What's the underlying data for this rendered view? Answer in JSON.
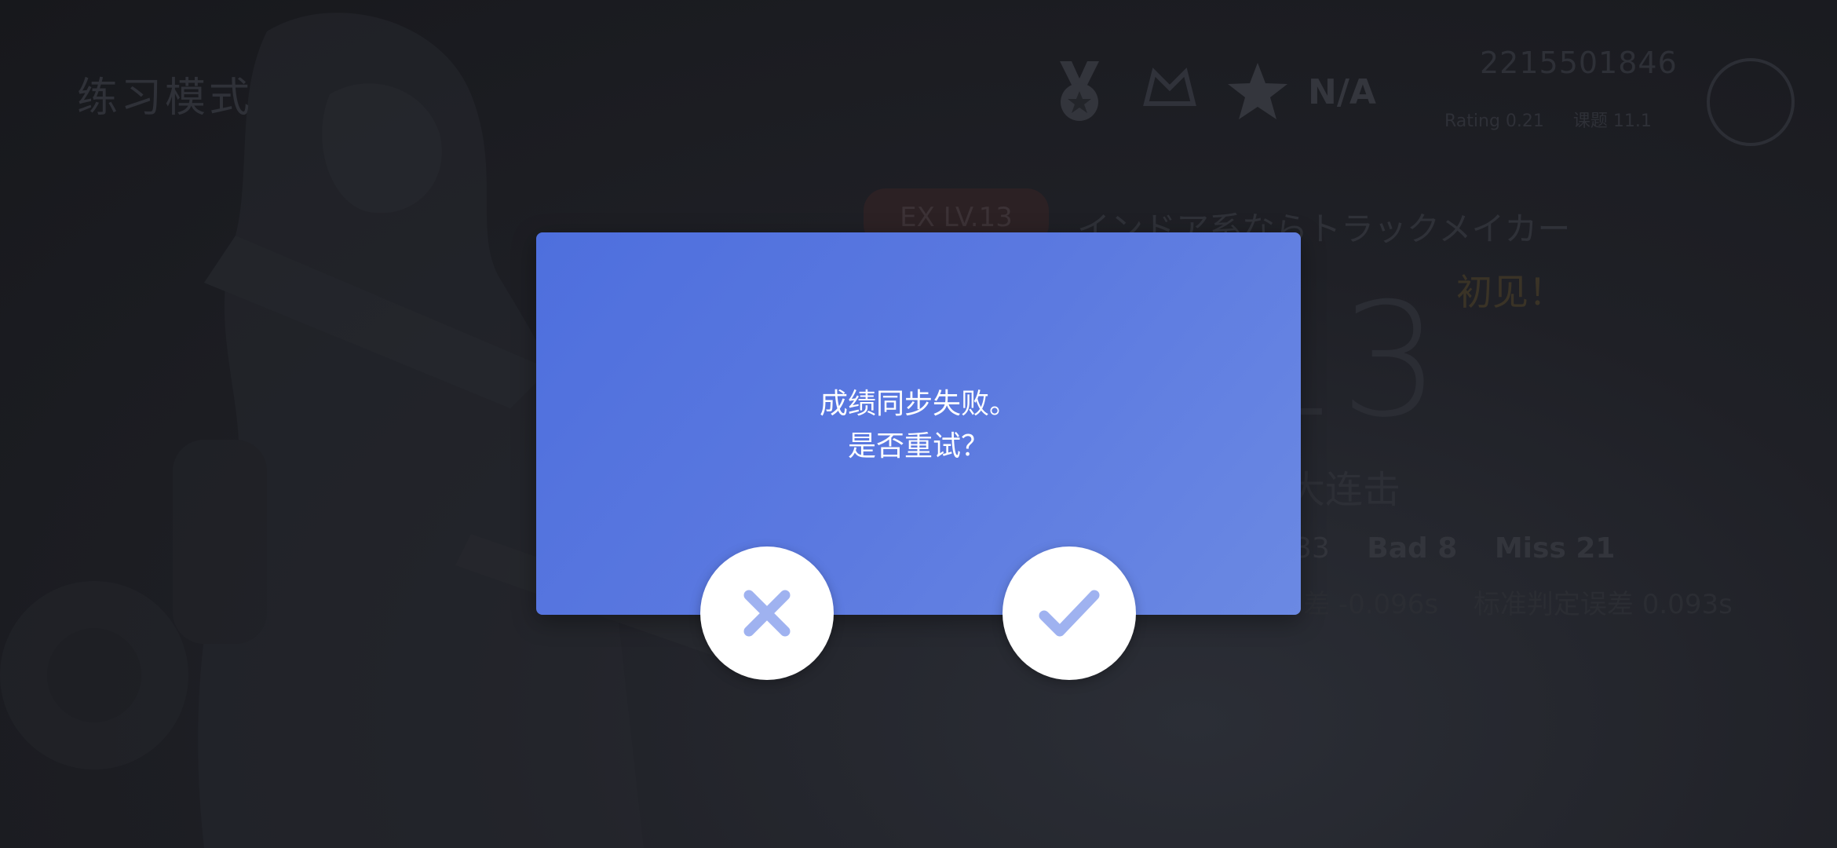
{
  "background": {
    "mode_title": "练习模式",
    "rank": "N/A",
    "player_id": "2215501846",
    "rating_label": "Rating 0.21",
    "rating_extra": "课题 11.1",
    "difficulty_badge": "EX  LV.13",
    "song_title": "インドア系ならトラックメイカー",
    "first_play_tag": "初见！",
    "score": "13",
    "combo_label": "大连击",
    "judgements": [
      {
        "label": "33",
        "strong": false
      },
      {
        "label": "Bad 8",
        "strong": true
      },
      {
        "label": "Miss 21",
        "strong": true
      }
    ],
    "errors": [
      "差 -0.096s",
      "标准判定误差 0.093s"
    ]
  },
  "dialog": {
    "line1": "成绩同步失败。",
    "line2": "是否重试？",
    "cancel_icon": "close-icon",
    "confirm_icon": "checkmark-icon",
    "accent": "#9fb2f0"
  },
  "colors": {
    "dialog_start": "#4e6fdd",
    "dialog_end": "#6b89e3",
    "button_bg": "#ffffff"
  }
}
